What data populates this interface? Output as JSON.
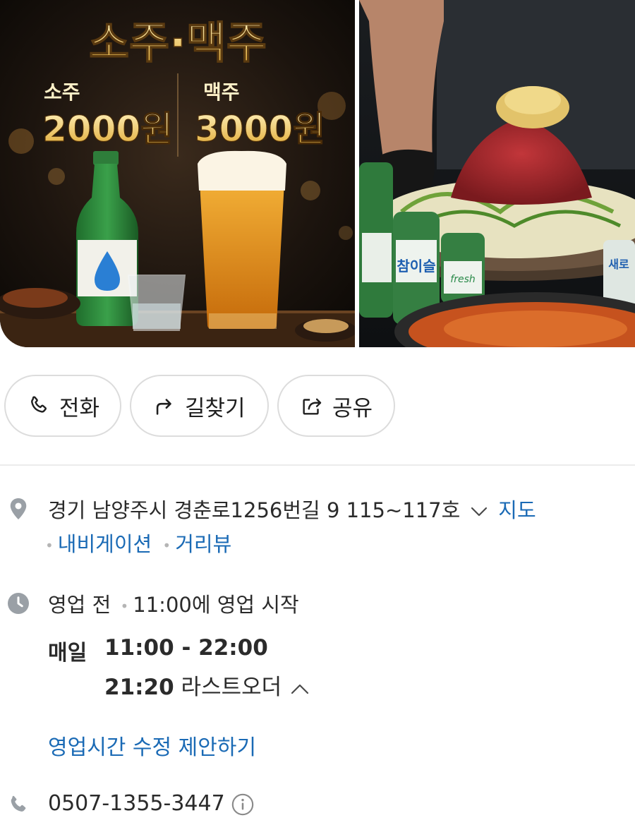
{
  "photo_left": {
    "headline": "소주·맥주",
    "soju_label": "소주",
    "soju_price": "2000원",
    "beer_label": "맥주",
    "beer_price": "3000원"
  },
  "photo_right": {
    "bottle_label_1": "참이슬",
    "bottle_label_2": "fresh",
    "bottle_label_3": "새로"
  },
  "actions": {
    "call_label": "전화",
    "route_label": "길찾기",
    "share_label": "공유"
  },
  "address": {
    "text": "경기 남양주시 경춘로1256번길 9 115~117호",
    "map_link": "지도",
    "navigation_link": "내비게이션",
    "streetview_link": "거리뷰"
  },
  "hours": {
    "status": "영업 전",
    "next_open": "11:00에 영업 시작",
    "day": "매일",
    "time": "11:00 - 22:00",
    "last_order_time": "21:20",
    "last_order_label": "라스트오더",
    "suggest_edit": "영업시간 수정 제안하기"
  },
  "phone": {
    "number": "0507-1355-3447"
  },
  "colors": {
    "link": "#1a6ab5",
    "icon_gray": "#9aa0a6",
    "border": "#dcdcdc"
  }
}
